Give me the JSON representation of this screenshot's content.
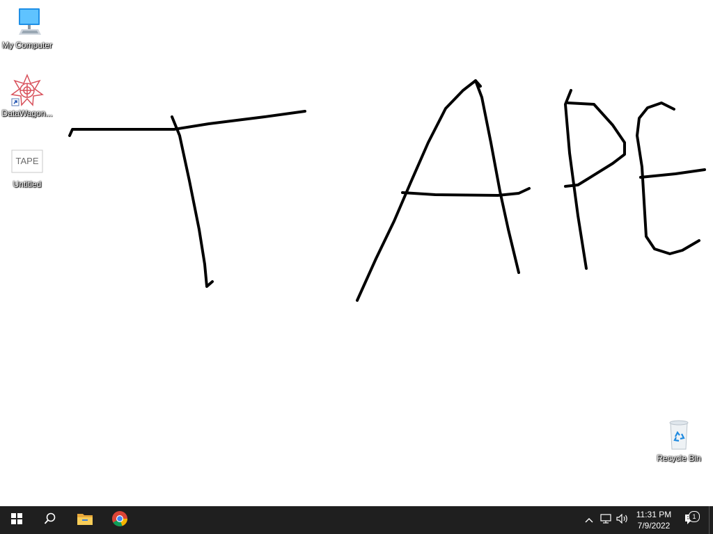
{
  "desktop": {
    "background": "#ffffff",
    "ink_color": "#000000",
    "icons": [
      {
        "label": "My Computer",
        "icon": "computer-icon"
      },
      {
        "label": "DataWagon...",
        "icon": "datawagon-shortcut-icon"
      },
      {
        "label": "Untitled",
        "icon": "image-file-icon",
        "thumbnail_text": "TAPE"
      },
      {
        "label": "Recycle Bin",
        "icon": "recycle-bin-icon"
      }
    ]
  },
  "taskbar": {
    "background": "#1f1f1f",
    "start_icon": "windows-start-icon",
    "search_icon": "search-icon",
    "pinned": [
      {
        "name": "File Explorer",
        "icon": "file-explorer-icon"
      },
      {
        "name": "Google Chrome",
        "icon": "chrome-icon"
      }
    ],
    "tray": {
      "chevron_icon": "chevron-up-icon",
      "network_icon": "network-icon",
      "volume_icon": "volume-icon",
      "time": "11:31 PM",
      "date": "7/9/2022",
      "notification_count": "1"
    }
  }
}
